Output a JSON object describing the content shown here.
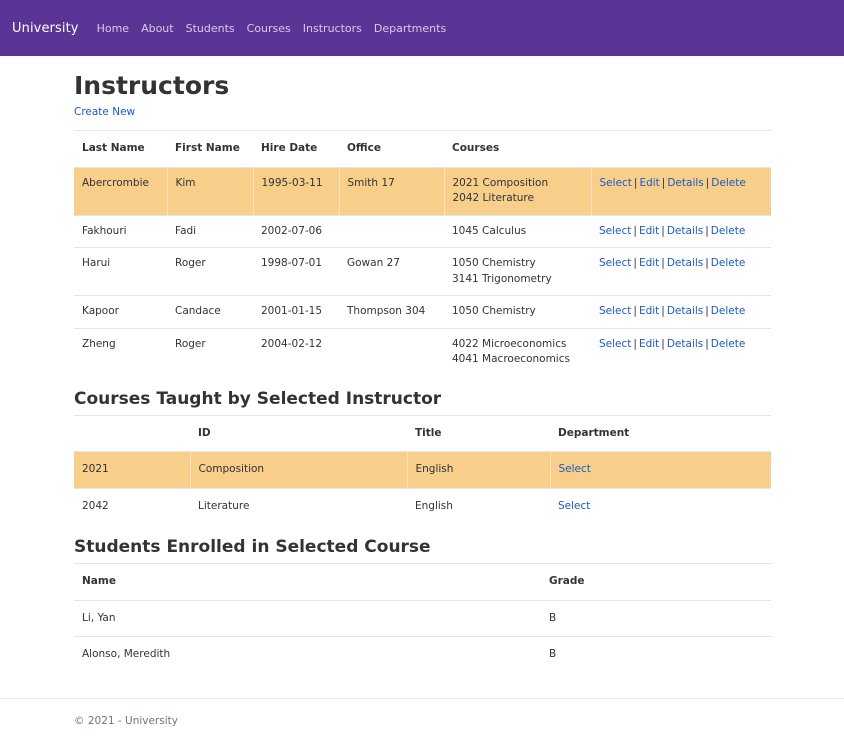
{
  "nav": {
    "brand": "University",
    "links": [
      "Home",
      "About",
      "Students",
      "Courses",
      "Instructors",
      "Departments"
    ]
  },
  "page": {
    "title": "Instructors",
    "create_new": "Create New"
  },
  "instructors": {
    "headers": [
      "Last Name",
      "First Name",
      "Hire Date",
      "Office",
      "Courses"
    ],
    "action_labels": {
      "select": "Select",
      "edit": "Edit",
      "details": "Details",
      "delete": "Delete",
      "separator": "|"
    },
    "rows": [
      {
        "last": "Abercrombie",
        "first": "Kim",
        "hire": "1995-03-11",
        "office": "Smith 17",
        "courses": [
          "2021 Composition",
          "2042 Literature"
        ],
        "selected": true
      },
      {
        "last": "Fakhouri",
        "first": "Fadi",
        "hire": "2002-07-06",
        "office": "",
        "courses": [
          "1045 Calculus"
        ],
        "selected": false
      },
      {
        "last": "Harui",
        "first": "Roger",
        "hire": "1998-07-01",
        "office": "Gowan 27",
        "courses": [
          "1050 Chemistry",
          "3141 Trigonometry"
        ],
        "selected": false
      },
      {
        "last": "Kapoor",
        "first": "Candace",
        "hire": "2001-01-15",
        "office": "Thompson 304",
        "courses": [
          "1050 Chemistry"
        ],
        "selected": false
      },
      {
        "last": "Zheng",
        "first": "Roger",
        "hire": "2004-02-12",
        "office": "",
        "courses": [
          "4022 Microeconomics",
          "4041 Macroeconomics"
        ],
        "selected": false
      }
    ]
  },
  "courses_section": {
    "title": "Courses Taught by Selected Instructor",
    "headers": [
      "",
      "ID",
      "Title",
      "Department"
    ],
    "rows": [
      {
        "number": "2021",
        "id": "Composition",
        "title": "English",
        "action": "Select",
        "selected": true
      },
      {
        "number": "2042",
        "id": "Literature",
        "title": "English",
        "action": "Select",
        "selected": false
      }
    ]
  },
  "students_section": {
    "title": "Students Enrolled in Selected Course",
    "headers": [
      "Name",
      "Grade"
    ],
    "rows": [
      {
        "name": "Li, Yan",
        "grade": "B"
      },
      {
        "name": "Alonso, Meredith",
        "grade": "B"
      }
    ]
  },
  "footer": {
    "text": "© 2021 - University"
  }
}
